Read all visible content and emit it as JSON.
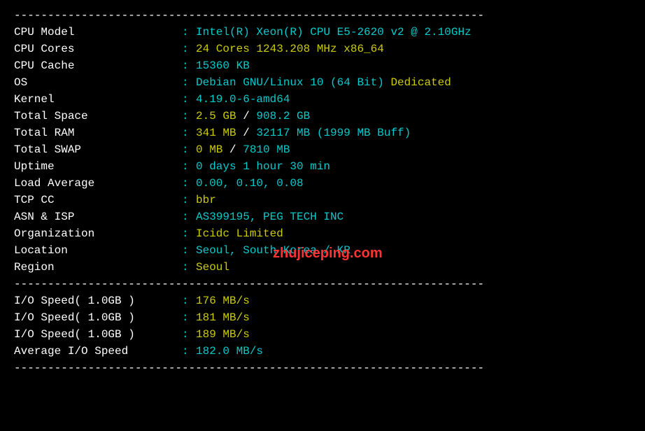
{
  "divider": "----------------------------------------------------------------------",
  "info": {
    "cpu_model": {
      "label": "CPU Model",
      "value": "Intel(R) Xeon(R) CPU E5-2620 v2 @ 2.10GHz"
    },
    "cpu_cores": {
      "label": "CPU Cores",
      "value": "24 Cores 1243.208 MHz x86_64"
    },
    "cpu_cache": {
      "label": "CPU Cache",
      "value": "15360 KB"
    },
    "os": {
      "label": "OS",
      "value": "Debian GNU/Linux 10 (64 Bit)",
      "tag": " Dedicated"
    },
    "kernel": {
      "label": "Kernel",
      "value": "4.19.0-6-amd64"
    },
    "total_space": {
      "label": "Total Space",
      "used": "2.5 GB",
      "sep": " / ",
      "total": "908.2 GB"
    },
    "total_ram": {
      "label": "Total RAM",
      "used": "341 MB",
      "sep": " / ",
      "total": "32117 MB",
      "buff": " (1999 MB Buff)"
    },
    "total_swap": {
      "label": "Total SWAP",
      "used": "0 MB",
      "sep": " / ",
      "total": "7810 MB"
    },
    "uptime": {
      "label": "Uptime",
      "value": "0 days 1 hour 30 min"
    },
    "load_average": {
      "label": "Load Average",
      "value": "0.00, 0.10, 0.08"
    },
    "tcp_cc": {
      "label": "TCP CC",
      "value": "bbr"
    },
    "asn_isp": {
      "label": "ASN & ISP",
      "value": "AS399195, PEG TECH INC"
    },
    "organization": {
      "label": "Organization",
      "value": "Icidc Limited"
    },
    "location": {
      "label": "Location",
      "value": "Seoul, South Korea / KR"
    },
    "region": {
      "label": "Region",
      "value": "Seoul"
    }
  },
  "io": {
    "test1": {
      "label": "I/O Speed( 1.0GB )",
      "value": "176 MB/s"
    },
    "test2": {
      "label": "I/O Speed( 1.0GB )",
      "value": "181 MB/s"
    },
    "test3": {
      "label": "I/O Speed( 1.0GB )",
      "value": "189 MB/s"
    },
    "avg": {
      "label": "Average I/O Speed",
      "value": "182.0 MB/s"
    }
  },
  "watermark": "zhujiceping.com"
}
